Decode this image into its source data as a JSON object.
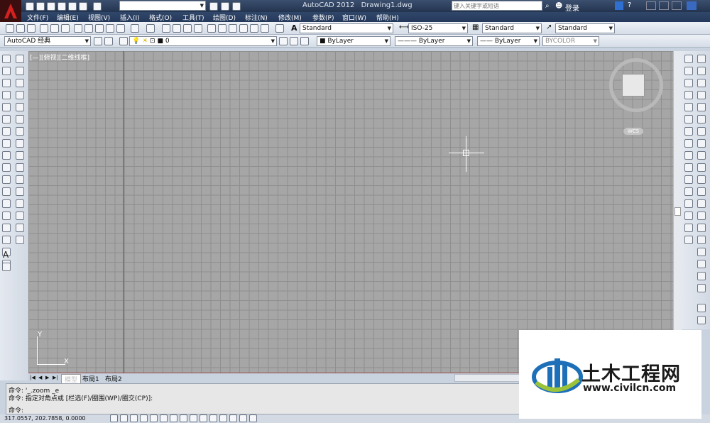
{
  "title_bar": {
    "workspace": "AutoCAD 经典",
    "app_title": "AutoCAD 2012",
    "doc_title": "Drawing1.dwg",
    "search_placeholder": "键入关键字或短语",
    "login": "登录"
  },
  "menu": [
    "文件(F)",
    "编辑(E)",
    "视图(V)",
    "插入(I)",
    "格式(O)",
    "工具(T)",
    "绘图(D)",
    "标注(N)",
    "修改(M)",
    "参数(P)",
    "窗口(W)",
    "帮助(H)"
  ],
  "styles_toolbar": {
    "text_style": "Standard",
    "dim_style": "ISO-25",
    "table_style": "Standard",
    "multileader_style": "Standard"
  },
  "workspace_combo": "AutoCAD 经典",
  "layer_combo": "0",
  "properties": {
    "color": "ByLayer",
    "linetype": "ByLayer",
    "lineweight": "ByLayer",
    "plotstyle": "BYCOLOR"
  },
  "viewport_label": "[—][俯视][二维线框]",
  "viewcube": {
    "wcs": "WCS"
  },
  "ucs": {
    "x": "X",
    "y": "Y"
  },
  "layout_tabs": [
    "模型",
    "布局1",
    "布局2"
  ],
  "command_lines": [
    "命令: '_.zoom _e",
    "命令: 指定对角点或 [栏选(F)/圈围(WP)/圈交(CP)]:",
    "命令:"
  ],
  "coords": "317.0557, 202.7858, 0.0000",
  "watermark": {
    "brand": "土木工程网",
    "url": "www.civilcn.com"
  }
}
